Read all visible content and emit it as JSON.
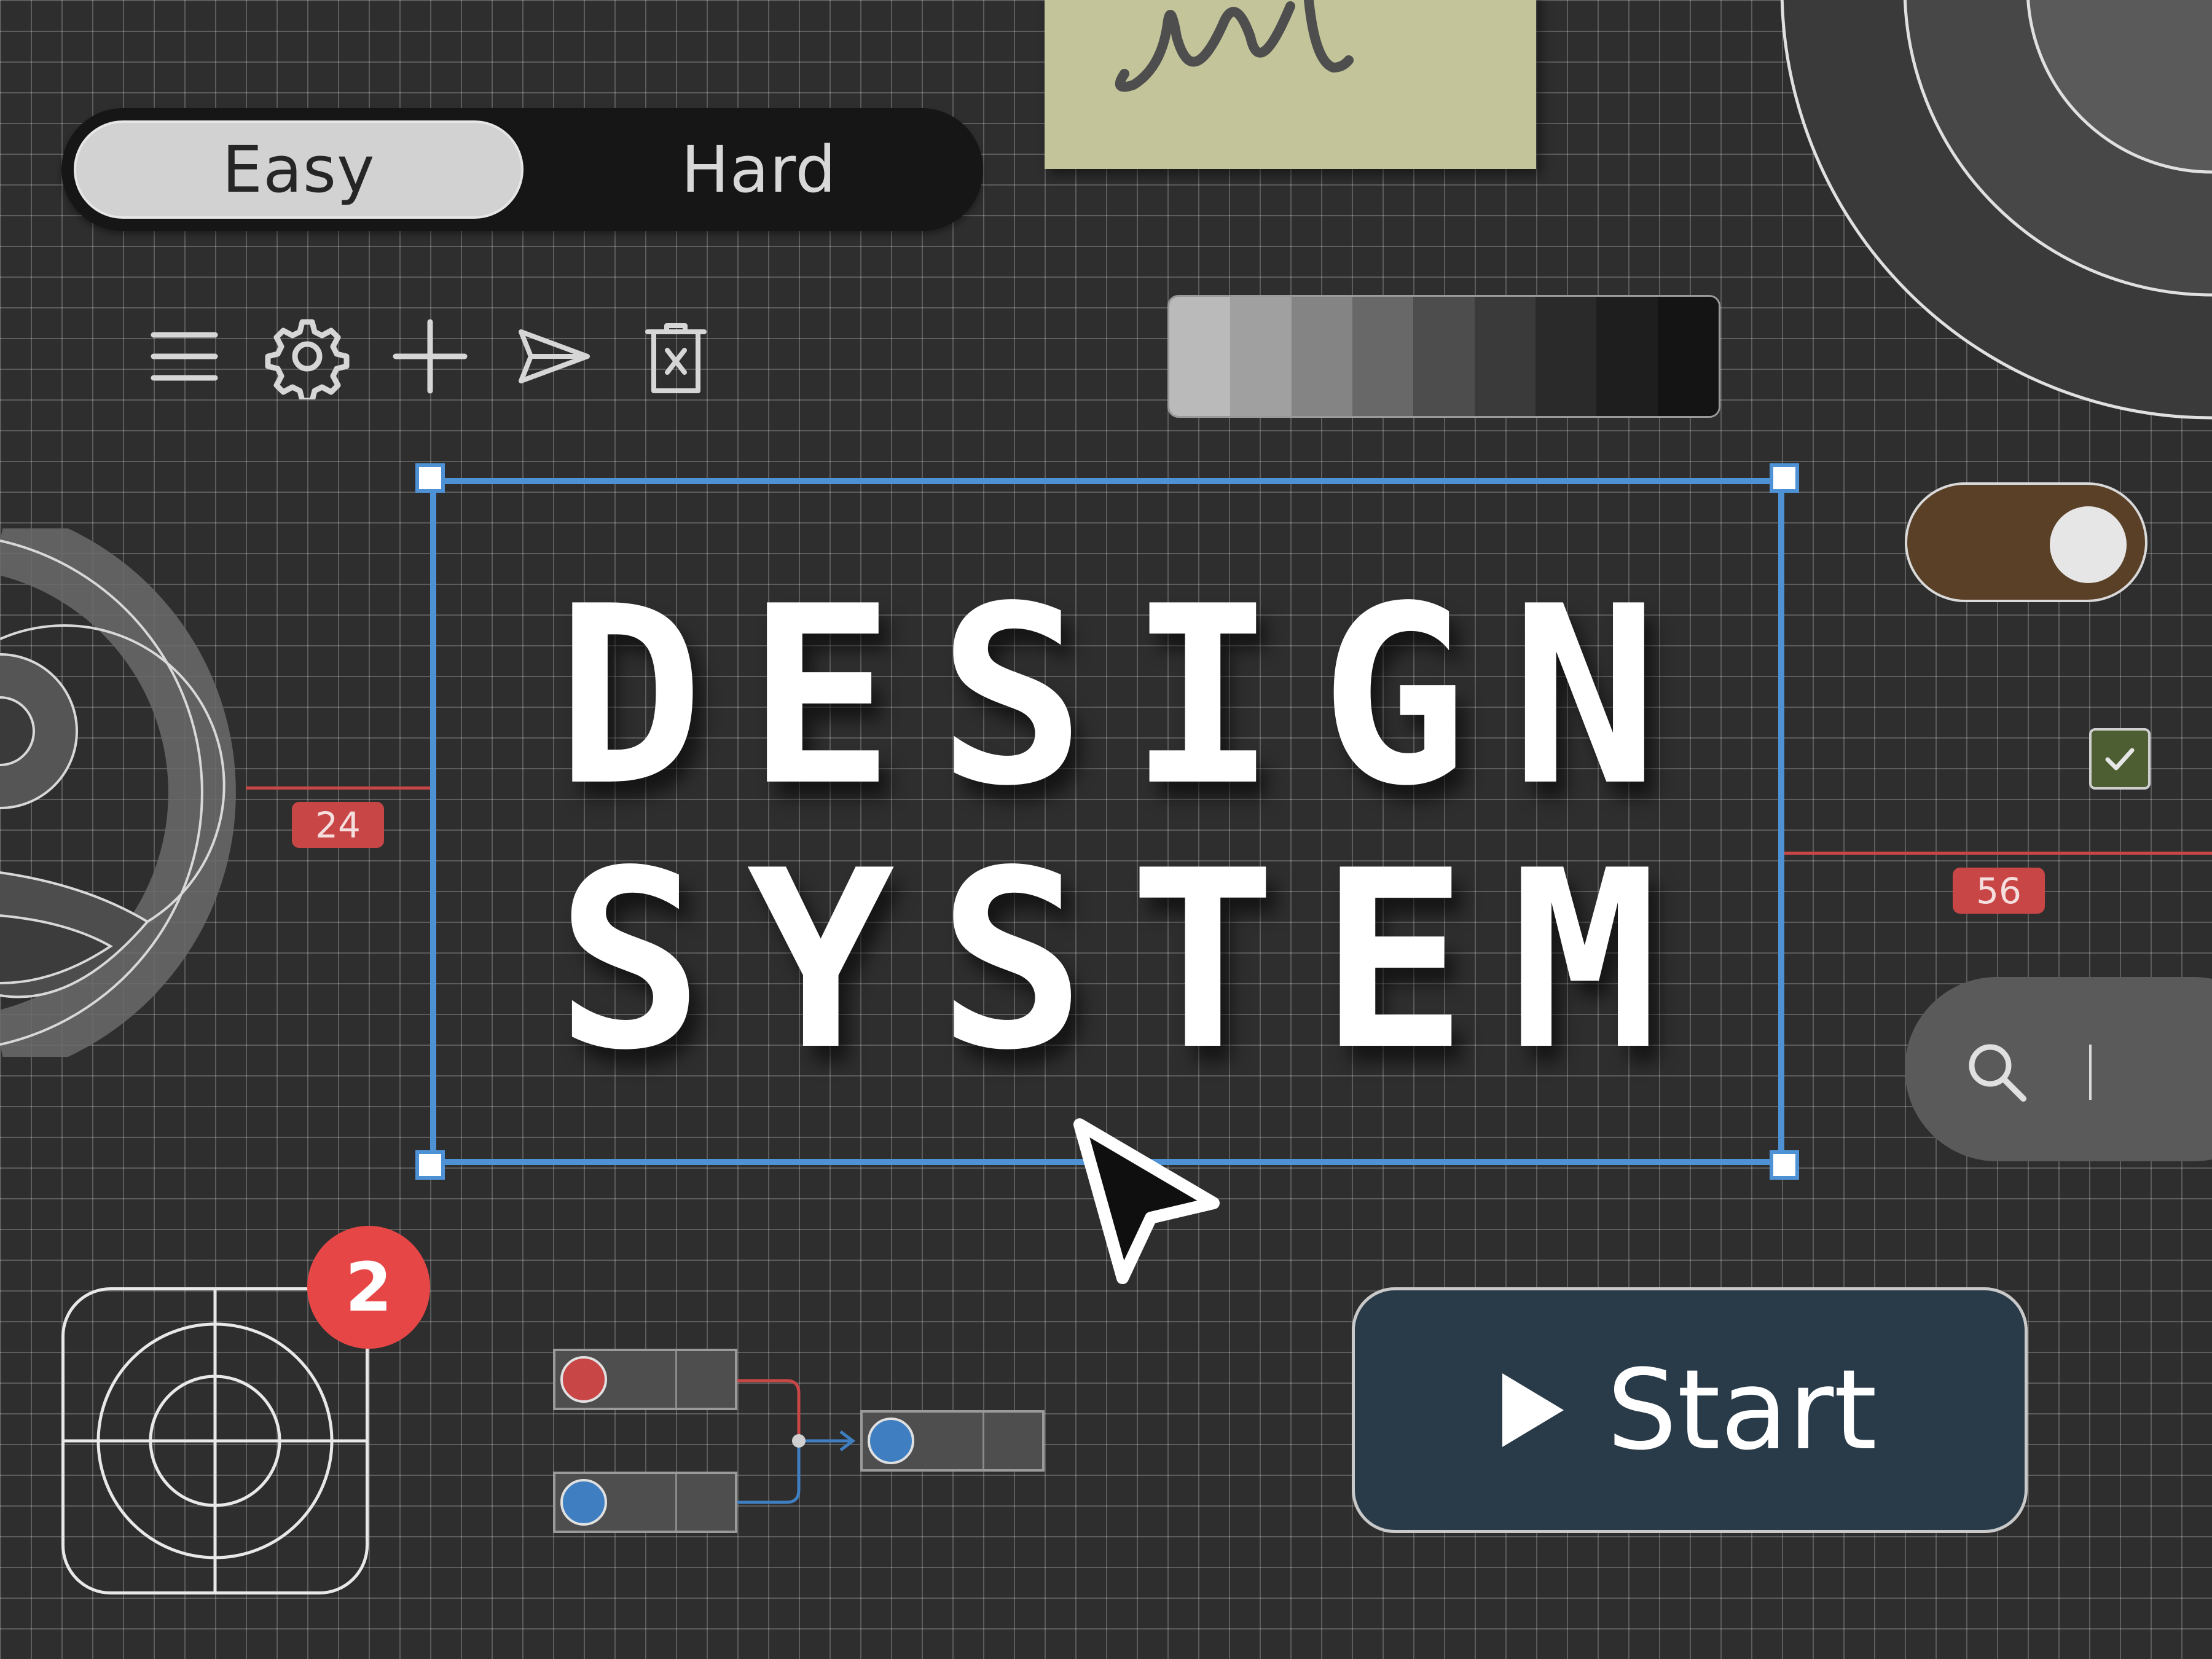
{
  "segmented_control": {
    "options": [
      "Easy",
      "Hard"
    ],
    "selected": "Easy"
  },
  "toolbar": {
    "icons": [
      "menu-icon",
      "gear-icon",
      "plus-icon",
      "send-icon",
      "trash-icon"
    ]
  },
  "palette": {
    "swatches": [
      "#bababa",
      "#a0a0a0",
      "#848484",
      "#686868",
      "#4d4d4d",
      "#3a3a3a",
      "#2a2a2a",
      "#1e1e1e",
      "#141414"
    ]
  },
  "hero": {
    "line1": "DESIGN",
    "line2": "SYSTEM"
  },
  "selection": {
    "color": "#4e91d4"
  },
  "measurements": {
    "left": "24",
    "right": "56"
  },
  "toggle": {
    "state": "on"
  },
  "checkbox": {
    "checked": true
  },
  "notification_badge": {
    "count": "2"
  },
  "start_button": {
    "label": "Start",
    "icon": "play-icon"
  },
  "node_graph": {
    "pin_colors": [
      "#c94646",
      "#3f7fc1",
      "#3f7fc1"
    ]
  },
  "colors": {
    "accent": "#4e91d4",
    "measure": "#c94646",
    "badge": "#e74646",
    "toggle_on": "#5a4027",
    "start_bg": "#293b49"
  }
}
